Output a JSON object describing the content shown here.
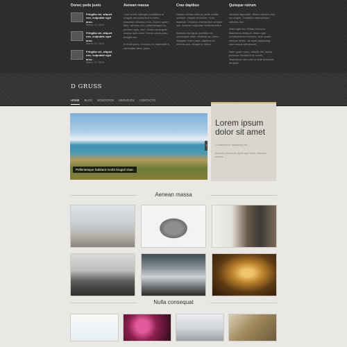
{
  "footer_widgets": {
    "col1": {
      "title": "Donec pede justo",
      "posts": [
        {
          "title": "Fringilla vel, aliquet nec, vulputate eget arcu.",
          "date": "Marzo 12, 2014"
        },
        {
          "title": "Fringilla vel, aliquet nec, vulputate eget arcu.",
          "date": "Marzo 12, 2014"
        },
        {
          "title": "Fringilla vel, aliquet nec, vulputate eget arcu.",
          "date": "Marzo 12, 2014"
        }
      ]
    },
    "col2": {
      "title": "Aenean massa",
      "p1": "Cum sociis natoque penatibus et magnis dis parturient montes, nascetur ridiculus mus. Donec quam felis, ultricies nec, pellentesque eu, pretium quis, sem. Nulla consequat massa quis enim. Donec pede justo, fringilla vel.",
      "p2": "In enim justo, rhoncus ut, imperdiet a, venenatis vitae, justo."
    },
    "col3": {
      "title": "Cras dapibus",
      "p1": "Nullam dictum felis eu pede mollis pretium. Integer tincidunt. Cras dapibus. Vivamus elementum semper nisi. Aenean vulputate eleifend tellus.",
      "p2": "Aenean leo ligula, porttitor eu, consequat vitae, eleifend ac, enim. Aliquam lorem ante, dapibus in, viverra quis, feugiat a, tellus."
    },
    "col4": {
      "title": "Quisque rutrum",
      "p1": "Aenean imperdiet. Etiam ultricies nisi vel augue. Curabitur ullamcorper ultricies nisi.",
      "p2": "Nam eget dui. Etiam rhoncus. Maecenas tempus, tellus eget condimentum rhoncus, sem quam semper libero, sit amet adipiscing sem neque sed ipsum.",
      "p3": "Nam quam nunc, blandit vel, luctus pulvinar, hendrerit id, lorem. Maecenas nec odio et ante tincidunt tempus."
    }
  },
  "header": {
    "logo": "D GRUSS",
    "nav": [
      "HOME",
      "BLOG",
      "NOSOTROS",
      "SERVICIOS",
      "CONTACTO"
    ],
    "active_nav": "HOME"
  },
  "hero": {
    "caption": "Pellentesque habitant morbi tirugali vitae.",
    "heading": "Lorem ipsum dolor sit amet",
    "sub1": "Consectetuer adipiscing elit",
    "sub2": "Aenean commodo ligula eget dolor. Aenean massa."
  },
  "sections": {
    "s1": "Aenean massa",
    "s2": "Nulla consequat"
  },
  "colors": {
    "accent": "#cdb37c",
    "topband": "#2b2b2b",
    "page": "#e9e8e4"
  }
}
